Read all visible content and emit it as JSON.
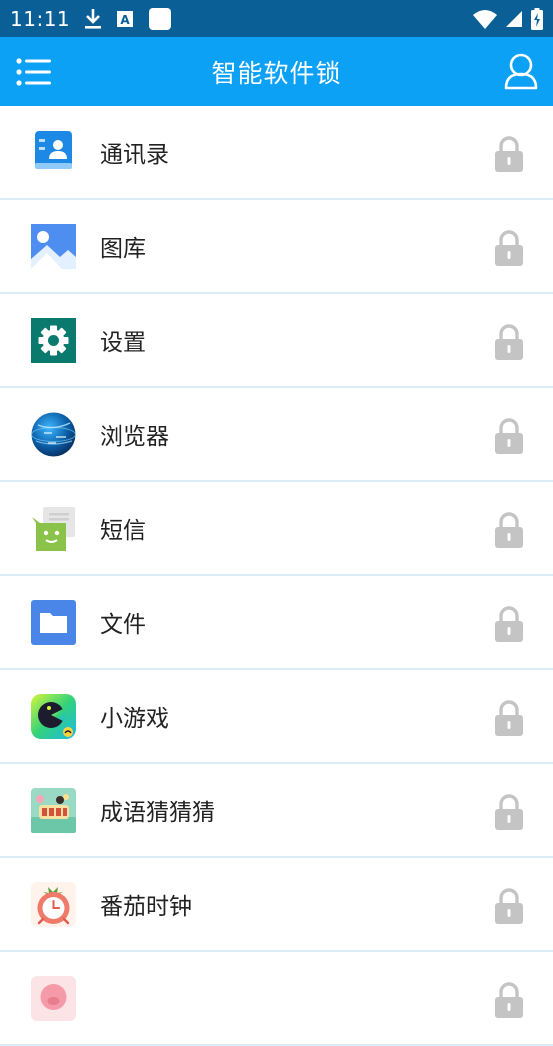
{
  "status_bar": {
    "time": "11:11",
    "icons": [
      "download-icon",
      "autofill-icon",
      "app-notification-icon",
      "wifi-icon",
      "signal-icon",
      "battery-charging-icon"
    ]
  },
  "app_bar": {
    "title": "智能软件锁",
    "menu_icon": "menu-icon",
    "user_icon": "user-icon"
  },
  "apps": [
    {
      "label": "通讯录",
      "icon": "contacts-icon",
      "locked": false
    },
    {
      "label": "图库",
      "icon": "gallery-icon",
      "locked": false
    },
    {
      "label": "设置",
      "icon": "settings-icon",
      "locked": false
    },
    {
      "label": "浏览器",
      "icon": "browser-icon",
      "locked": false
    },
    {
      "label": "短信",
      "icon": "messages-icon",
      "locked": false
    },
    {
      "label": "文件",
      "icon": "files-icon",
      "locked": false
    },
    {
      "label": "小游戏",
      "icon": "minigame-icon",
      "locked": false
    },
    {
      "label": "成语猜猜猜",
      "icon": "idiom-game-icon",
      "locked": false
    },
    {
      "label": "番茄时钟",
      "icon": "tomato-clock-icon",
      "locked": false
    },
    {
      "label": "",
      "icon": "pig-app-icon",
      "locked": false
    }
  ],
  "colors": {
    "status_bar": "#0a5f96",
    "app_bar": "#0da1f5",
    "divider": "#dcecf6",
    "lock_gray": "#c4c4c4"
  }
}
